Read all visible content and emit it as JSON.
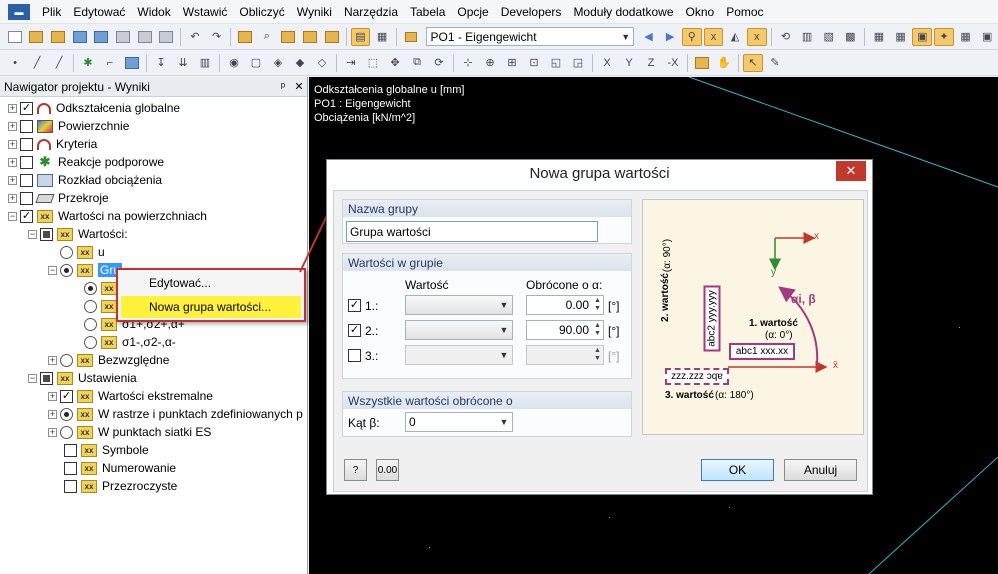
{
  "menu": {
    "items": [
      "Plik",
      "Edytować",
      "Widok",
      "Wstawić",
      "Obliczyć",
      "Wyniki",
      "Narzędzia",
      "Tabela",
      "Opcje",
      "Developers",
      "Moduły dodatkowe",
      "Okno",
      "Pomoc"
    ]
  },
  "toolbar": {
    "load_case": "PO1 - Eigengewicht"
  },
  "navigator": {
    "title": "Nawigator projektu - Wyniki",
    "pin": "ᵖ",
    "close": "✕",
    "items": [
      {
        "label": "Odkształcenia globalne",
        "icon": "deformation-icon"
      },
      {
        "label": "Powierzchnie",
        "icon": "surface-icon"
      },
      {
        "label": "Kryteria",
        "icon": "criteria-icon"
      },
      {
        "label": "Reakcje podporowe",
        "icon": "support-icon"
      },
      {
        "label": "Rozkład obciążenia",
        "icon": "load-icon"
      },
      {
        "label": "Przekroje",
        "icon": "section-icon"
      },
      {
        "label": "Wartości na powierzchniach",
        "icon": "values-icon"
      },
      {
        "label": "Wartości:",
        "icon": "values-icon"
      },
      {
        "label": "u",
        "icon": "values-icon"
      },
      {
        "label": "Gru",
        "icon": "values-icon"
      },
      {
        "label": "",
        "icon": "values-icon"
      },
      {
        "label": "",
        "icon": "values-icon"
      },
      {
        "label": "σ1+,σ2+,α+",
        "icon": "values-icon"
      },
      {
        "label": "σ1-,σ2-,α-",
        "icon": "values-icon"
      },
      {
        "label": "Bezwzględne",
        "icon": "values-icon"
      },
      {
        "label": "Ustawienia",
        "icon": "values-icon"
      },
      {
        "label": "Wartości ekstremalne",
        "icon": "values-icon"
      },
      {
        "label": "W rastrze i punktach zdefiniowanych p",
        "icon": "values-icon"
      },
      {
        "label": "W punktach siatki ES",
        "icon": "values-icon"
      },
      {
        "label": "Symbole",
        "icon": "values-icon"
      },
      {
        "label": "Numerowanie",
        "icon": "values-icon"
      },
      {
        "label": "Przezroczyste",
        "icon": "values-icon"
      }
    ]
  },
  "context_menu": {
    "edit": "Edytować...",
    "new_group": "Nowa grupa wartości..."
  },
  "graphics": {
    "line1": "Odkształcenia globalne u [mm]",
    "line2": "PO1 : Eigengewicht",
    "line3": "Obciążenia [kN/m^2]"
  },
  "dialog": {
    "title": "Nowa grupa wartości",
    "close": "✕",
    "group_name_header": "Nazwa grupy",
    "group_name_value": "Grupa wartości",
    "values_header": "Wartości w grupie",
    "col_value": "Wartość",
    "col_rotated": "Obrócone o α:",
    "rows": [
      {
        "label": "1.:",
        "checked": true,
        "angle": "0.00",
        "unit": "[°]"
      },
      {
        "label": "2.:",
        "checked": true,
        "angle": "90.00",
        "unit": "[°]"
      },
      {
        "label": "3.:",
        "checked": false,
        "angle": "",
        "unit": "[°]"
      }
    ],
    "all_rotated_header": "Wszystkie wartości obrócone o",
    "angle_beta_label": "Kąt β:",
    "angle_beta_value": "0",
    "ok": "OK",
    "cancel": "Anuluj",
    "illustration": {
      "axis_x": "x",
      "axis_y": "y",
      "axis_xbar": "x̄",
      "alpha_beta": "αi, β",
      "v1_title": "1. wartość",
      "v1_angle": "(α: 0°)",
      "v1_box": "abc1 xxx.xx",
      "v2_title": "2. wartość",
      "v2_angle": "(α: 90°)",
      "v2_box": "abc2 yyy.yyy",
      "v3_title": "3. wartość",
      "v3_angle": "(α: 180°)",
      "v3_box": "zzz.zzz ɔqɐ"
    }
  }
}
